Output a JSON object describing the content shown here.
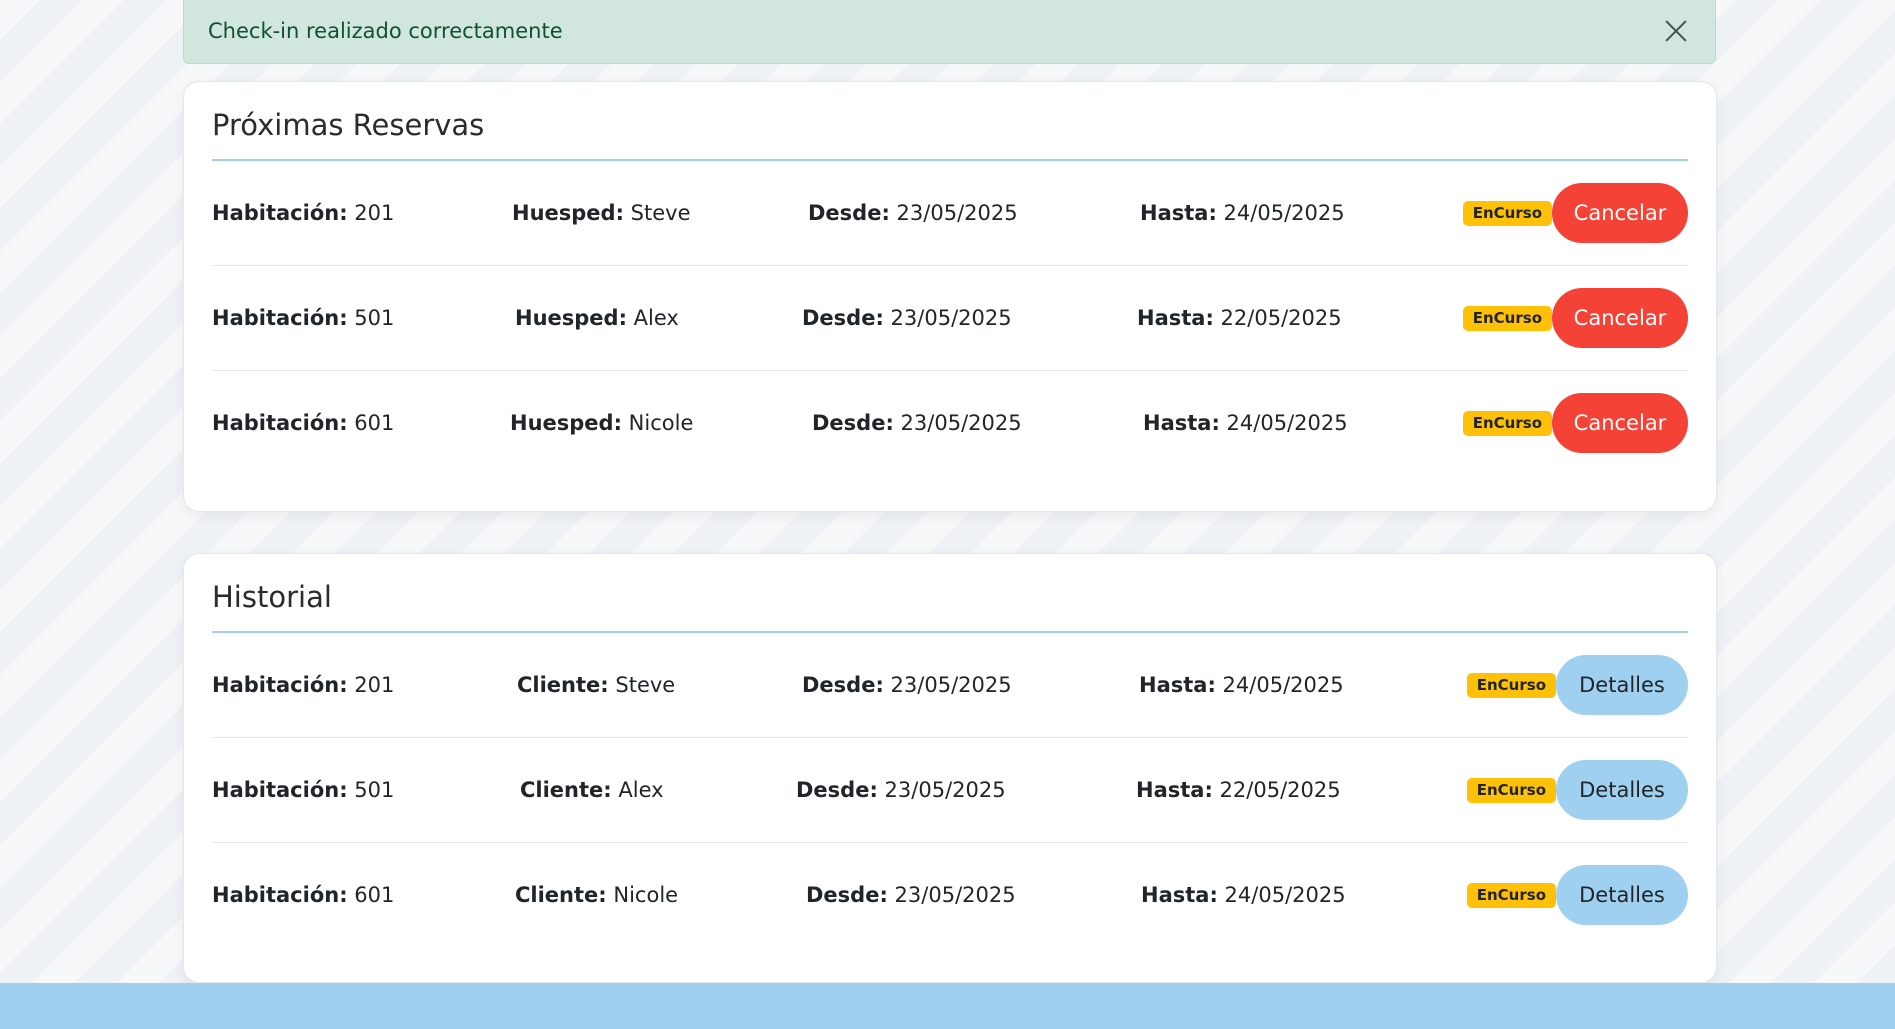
{
  "alert": {
    "message": "Check-in realizado correctamente"
  },
  "reservas": {
    "title": "Próximas Reservas",
    "room_label": "Habitación:",
    "guest_label": "Huesped:",
    "from_label": "Desde:",
    "to_label": "Hasta:",
    "rows": [
      {
        "room": "201",
        "guest": "Steve",
        "from": "23/05/2025",
        "to": "24/05/2025",
        "status": "EnCurso",
        "action": "Cancelar"
      },
      {
        "room": "501",
        "guest": "Alex",
        "from": "23/05/2025",
        "to": "22/05/2025",
        "status": "EnCurso",
        "action": "Cancelar"
      },
      {
        "room": "601",
        "guest": "Nicole",
        "from": "23/05/2025",
        "to": "24/05/2025",
        "status": "EnCurso",
        "action": "Cancelar"
      }
    ]
  },
  "historial": {
    "title": "Historial",
    "room_label": "Habitación:",
    "client_label": "Cliente:",
    "from_label": "Desde:",
    "to_label": "Hasta:",
    "rows": [
      {
        "room": "201",
        "client": "Steve",
        "from": "23/05/2025",
        "to": "24/05/2025",
        "status": "EnCurso",
        "action": "Detalles"
      },
      {
        "room": "501",
        "client": "Alex",
        "from": "23/05/2025",
        "to": "22/05/2025",
        "status": "EnCurso",
        "action": "Detalles"
      },
      {
        "room": "601",
        "client": "Nicole",
        "from": "23/05/2025",
        "to": "24/05/2025",
        "status": "EnCurso",
        "action": "Detalles"
      }
    ]
  },
  "colors": {
    "alert_bg": "#d1e7dd",
    "alert_text": "#0f5132",
    "cancel_button": "#f44336",
    "details_button": "#9fd0f0",
    "status_badge": "#ffc107",
    "footer_bar": "#9fd0f0"
  }
}
